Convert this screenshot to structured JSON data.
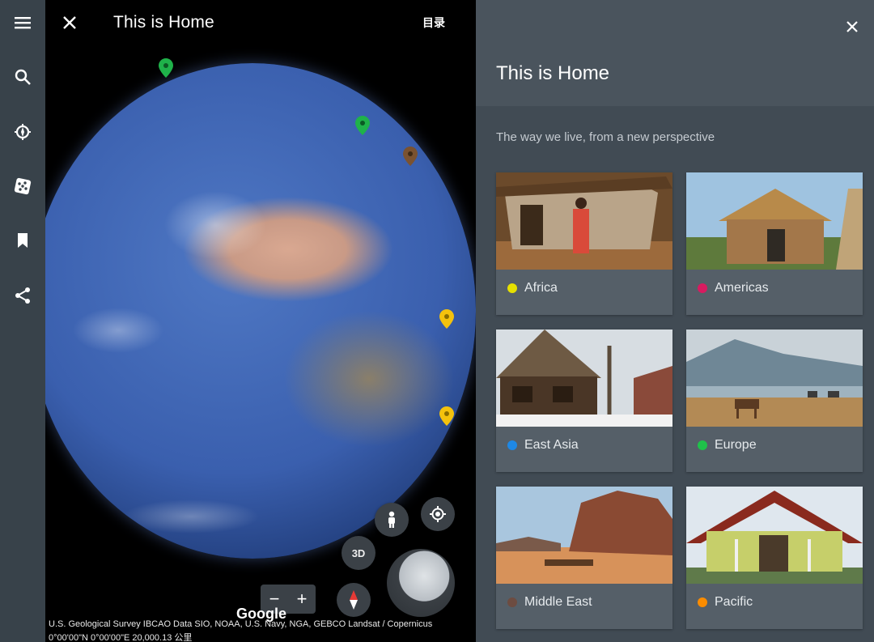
{
  "map": {
    "title": "This is Home",
    "toc_label": "目录",
    "google_label": "Google",
    "attribution": "U.S. Geological Survey  IBCAO  Data SIO, NOAA, U.S. Navy, NGA, GEBCO  Landsat / Copernicus",
    "coordinates": "0°00'00\"N 0°00'00\"E   20,000.13 公里",
    "controls": {
      "three_d": "3D",
      "zoom_out": "−",
      "zoom_in": "+"
    }
  },
  "sidebar": {
    "icons": [
      "menu-icon",
      "search-icon",
      "voyager-icon",
      "dice-icon",
      "bookmark-icon",
      "share-icon"
    ]
  },
  "panel": {
    "title": "This is Home",
    "subtitle": "The way we live, from a new perspective",
    "cards": [
      {
        "label": "Africa",
        "dot_color": "#e6e000"
      },
      {
        "label": "Americas",
        "dot_color": "#d81b60"
      },
      {
        "label": "East Asia",
        "dot_color": "#1e88e5"
      },
      {
        "label": "Europe",
        "dot_color": "#1fc14a"
      },
      {
        "label": "Middle East",
        "dot_color": "#6d4c41"
      },
      {
        "label": "Pacific",
        "dot_color": "#fb8c00"
      }
    ]
  },
  "colors": {
    "rail_bg": "#38424a",
    "panel_bg": "#414b54",
    "panel_header_bg": "#4a545d",
    "card_bg": "#555f68",
    "pin_green": "#1fb24a",
    "pin_yellow": "#f4c20d",
    "pin_brown": "#7a5230"
  }
}
